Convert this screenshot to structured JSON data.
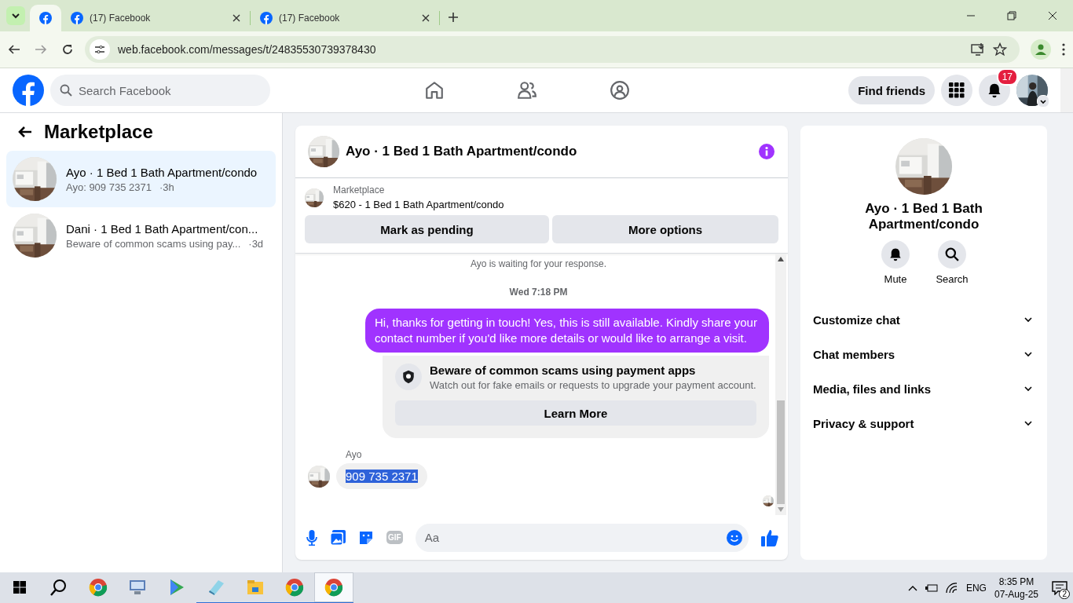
{
  "browser": {
    "tabs": [
      {
        "kind": "pinned",
        "selected": true
      },
      {
        "kind": "normal",
        "title": "(17) Facebook",
        "selected": false
      },
      {
        "kind": "normal",
        "title": "(17) Facebook",
        "selected": false
      }
    ],
    "url": "web.facebook.com/messages/t/24835530739378430"
  },
  "header": {
    "search": {
      "placeholder": "Search Facebook"
    },
    "find_friends": "Find friends",
    "notification_count": "17"
  },
  "sidebar": {
    "title": "Marketplace",
    "conversations": [
      {
        "title": "Ayo · 1 Bed 1 Bath Apartment/condo",
        "preview": "Ayo: 909 735 2371",
        "time": "·3h",
        "selected": true
      },
      {
        "title": "Dani · 1 Bed 1 Bath Apartment/con...",
        "preview": "Beware of common scams using pay...",
        "time": "·3d",
        "selected": false
      }
    ]
  },
  "chat": {
    "title": "Ayo · 1 Bed 1 Bath Apartment/condo",
    "listing": {
      "label": "Marketplace",
      "title": "$620 - 1 Bed 1 Bath Apartment/condo",
      "buttons": [
        "Mark as pending",
        "More options"
      ]
    },
    "messages": [
      {
        "kind": "system",
        "text": "Ayo is waiting for your response."
      },
      {
        "kind": "timestamp",
        "text": "Wed 7:18 PM"
      },
      {
        "kind": "outgoing",
        "text": "Hi, thanks for getting in touch! Yes, this is still available. Kindly share your contact number if you'd like more details or would like to arrange a visit."
      },
      {
        "kind": "notice",
        "title": "Beware of common scams using payment apps",
        "text": "Watch out for fake emails or requests to upgrade your payment account.",
        "button": "Learn More"
      },
      {
        "kind": "incoming",
        "sender": "Ayo",
        "text": "909 735 2371",
        "highlighted": true
      }
    ],
    "composer": {
      "gif": "GIF",
      "placeholder": "Aa"
    }
  },
  "details": {
    "title": "Ayo · 1 Bed 1 Bath Apartment/condo",
    "actions": [
      "Mute",
      "Search"
    ],
    "sections": [
      {
        "label": "Customize chat",
        "expanded": false
      },
      {
        "label": "Chat members",
        "expanded": false
      },
      {
        "label": "Media, files and links",
        "expanded": false
      },
      {
        "label": "Privacy & support",
        "expanded": false
      }
    ]
  },
  "taskbar": {
    "apps": [
      {
        "kind": "chrome",
        "running": false,
        "selected": false
      },
      {
        "kind": "monitor",
        "running": false,
        "selected": false
      },
      {
        "kind": "play",
        "running": false,
        "selected": false
      },
      {
        "kind": "notepad",
        "running": true,
        "selected": false
      },
      {
        "kind": "folder",
        "running": true,
        "selected": false
      },
      {
        "kind": "chrome",
        "running": true,
        "selected": false
      },
      {
        "kind": "chrome",
        "running": true,
        "selected": true
      }
    ],
    "language": "ENG",
    "time": "8:35 PM",
    "date": "07-Aug-25",
    "notifications": "2"
  }
}
